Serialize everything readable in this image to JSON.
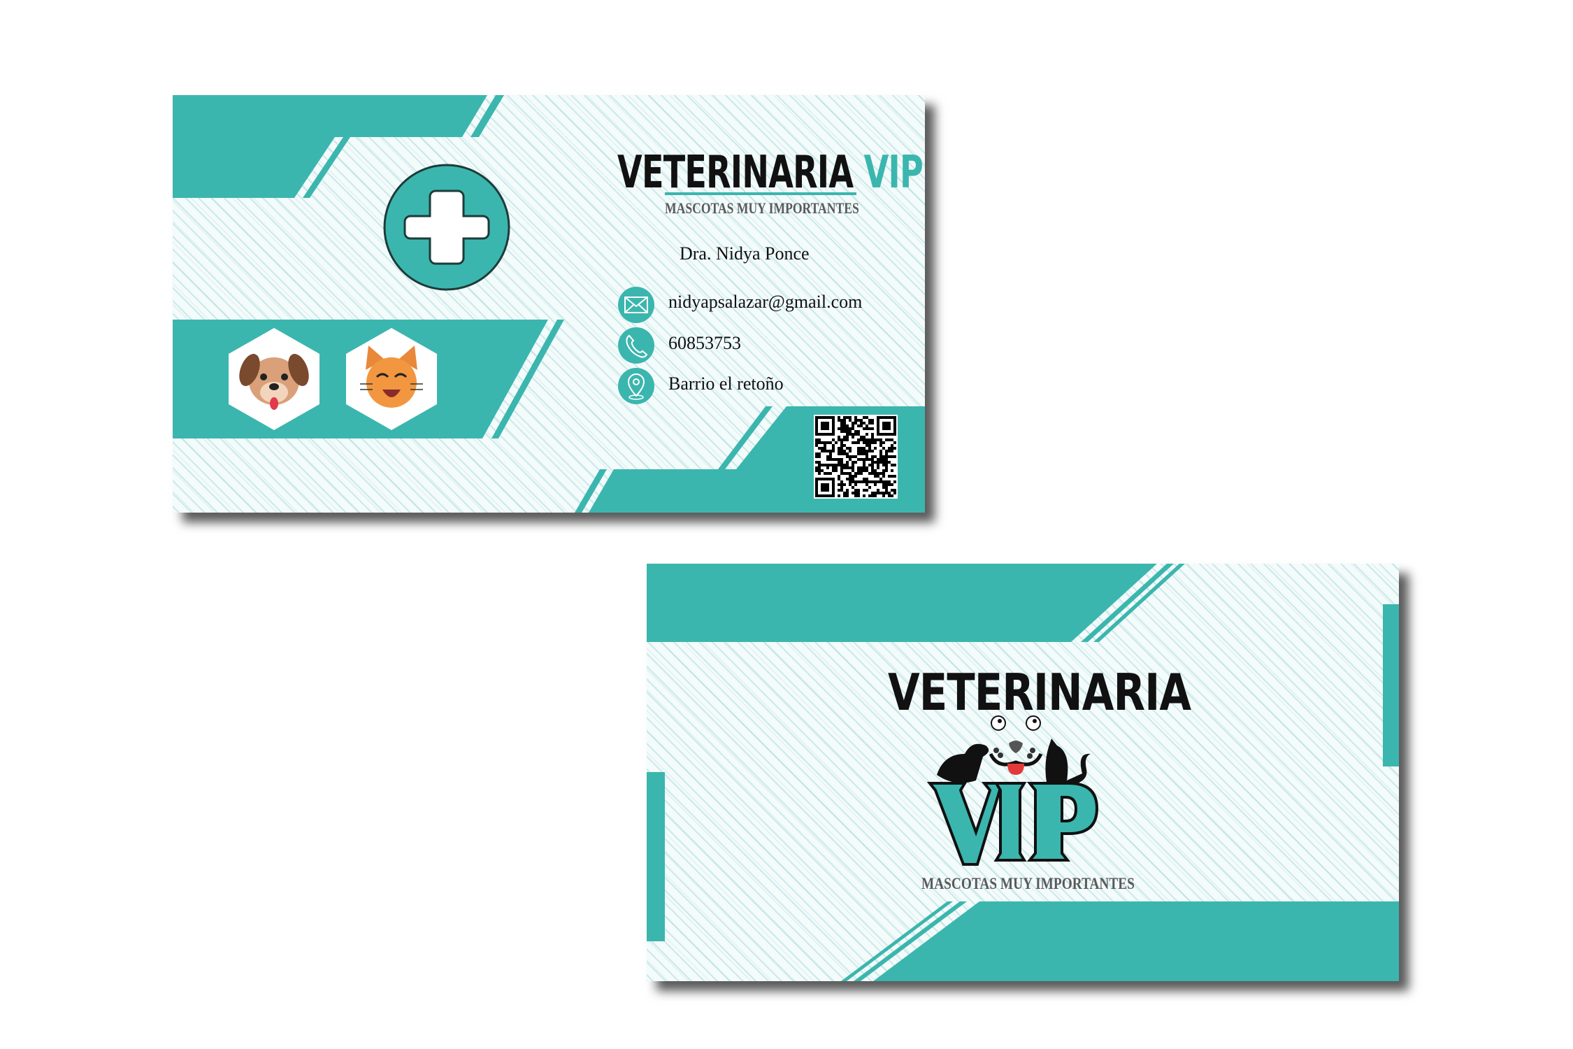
{
  "colors": {
    "teal": "#3bb6ae",
    "text": "#111111",
    "subtitle": "#5a5a5a"
  },
  "front": {
    "brand_main": "VETERINARIA",
    "brand_accent": "VIP",
    "tagline": "MASCOTAS MUY IMPORTANTES",
    "name": "Dra. Nidya Ponce",
    "contacts": [
      {
        "icon": "envelope-icon",
        "text": "nidyapsalazar@gmail.com"
      },
      {
        "icon": "phone-icon",
        "text": "60853753"
      },
      {
        "icon": "location-pin-icon",
        "text": "Barrio el retoño"
      }
    ],
    "icons": [
      "medical-cross-icon",
      "dog-face-icon",
      "cat-face-icon",
      "qr-code"
    ]
  },
  "back": {
    "brand_main": "VETERINARIA",
    "logo_text": "VIP",
    "tagline": "MASCOTAS MUY IMPORTANTES"
  }
}
